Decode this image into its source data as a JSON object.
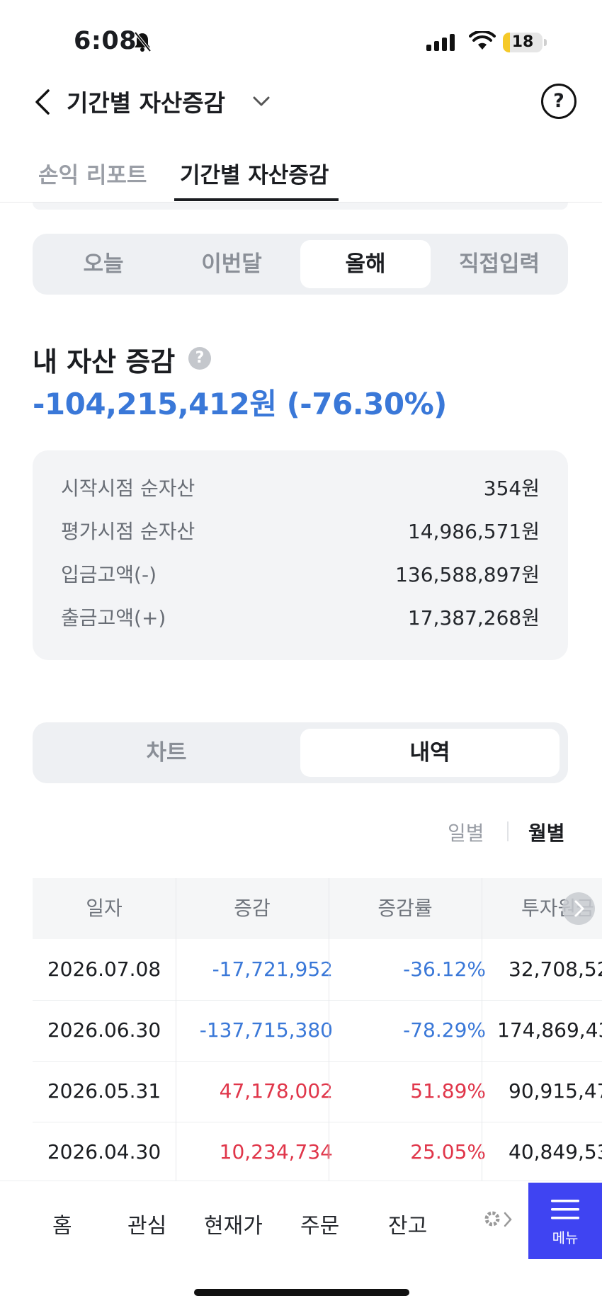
{
  "status_bar": {
    "time": "6:08",
    "battery": "18",
    "battery_level": 0.18
  },
  "header": {
    "title": "기간별 자산증감"
  },
  "tabs": [
    {
      "label": "손익 리포트"
    },
    {
      "label": "기간별 자산증감"
    }
  ],
  "period_tabs": [
    {
      "label": "오늘"
    },
    {
      "label": "이번달"
    },
    {
      "label": "올해"
    },
    {
      "label": "직접입력"
    }
  ],
  "asset": {
    "title": "내 자산 증감",
    "value": "-104,215,412원 (-76.30%)",
    "summary": [
      {
        "label": "시작시점 순자산",
        "value": "354원"
      },
      {
        "label": "평가시점 순자산",
        "value": "14,986,571원"
      },
      {
        "label": "입금고액(-)",
        "value": "136,588,897원"
      },
      {
        "label": "출금고액(+)",
        "value": "17,387,268원"
      }
    ]
  },
  "view_tabs": [
    {
      "label": "차트"
    },
    {
      "label": "내역"
    }
  ],
  "toggle": {
    "daily": "일별",
    "monthly": "월별"
  },
  "table": {
    "headers": [
      "일자",
      "증감",
      "증감률",
      "투자원금"
    ],
    "rows": [
      {
        "date": "2026.07.08",
        "change": "-17,721,952",
        "rate": "-36.12%",
        "principal": "32,708,52"
      },
      {
        "date": "2026.06.30",
        "change": "-137,715,380",
        "rate": "-78.29%",
        "principal": "174,869,43"
      },
      {
        "date": "2026.05.31",
        "change": "47,178,002",
        "rate": "51.89%",
        "principal": "90,915,47"
      },
      {
        "date": "2026.04.30",
        "change": "10,234,734",
        "rate": "25.05%",
        "principal": "40,849,53"
      }
    ]
  },
  "nav": {
    "items": [
      "홈",
      "관심",
      "현재가",
      "주문",
      "잔고"
    ],
    "menu": "메뉴"
  },
  "colors": {
    "negative": "#3a78d8",
    "positive": "#e0364a",
    "menu_bg": "#3f44f2"
  }
}
